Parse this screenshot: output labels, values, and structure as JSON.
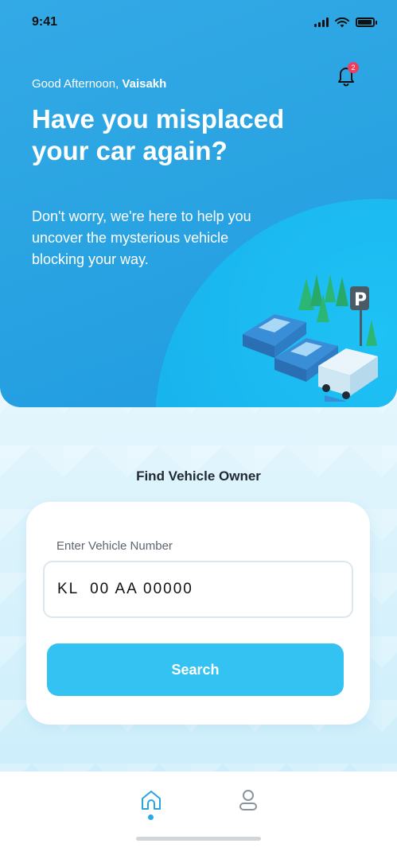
{
  "status_bar": {
    "time": "9:41"
  },
  "header": {
    "greeting_prefix": "Good Afternoon, ",
    "user_name": "Vaisakh",
    "notification_count": "2",
    "headline": "Have you misplaced your car again?",
    "subtext": "Don't worry, we're here to help you uncover the mysterious vehicle blocking your way."
  },
  "main": {
    "section_title": "Find Vehicle Owner",
    "field_label": "Enter Vehicle Number",
    "vehicle_input_value": "KL  00 AA 00000",
    "search_label": "Search"
  },
  "bottom_nav": {
    "items": [
      {
        "icon": "home-icon",
        "active": true
      },
      {
        "icon": "profile-icon",
        "active": false
      }
    ]
  },
  "colors": {
    "hero": "#2aa3e2",
    "accent": "#33c2f1",
    "badge": "#ef3e5c"
  }
}
